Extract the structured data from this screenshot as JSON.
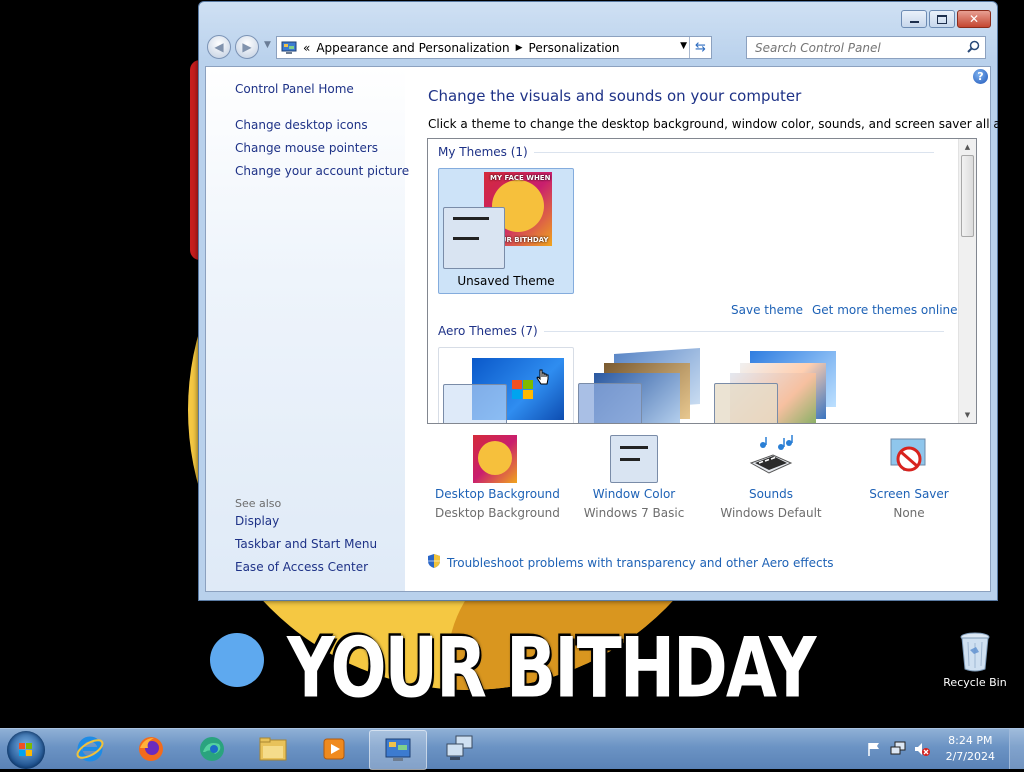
{
  "wallpaper": {
    "caption": "YOUR BITHDAY",
    "meme_text_top": "MY FACE WHEN",
    "meme_text_bottom": "YOUR BITHDAY"
  },
  "desktop": {
    "recycle_bin_label": "Recycle Bin"
  },
  "window": {
    "breadcrumb": {
      "overflow": "«",
      "segments": [
        "Appearance and Personalization",
        "Personalization"
      ]
    },
    "search_placeholder": "Search Control Panel",
    "help_glyph": "?"
  },
  "left_pane": {
    "home": "Control Panel Home",
    "links": [
      "Change desktop icons",
      "Change mouse pointers",
      "Change your account picture"
    ],
    "see_also_label": "See also",
    "see_also": [
      "Display",
      "Taskbar and Start Menu",
      "Ease of Access Center"
    ]
  },
  "main": {
    "title": "Change the visuals and sounds on your computer",
    "description": "Click a theme to change the desktop background, window color, sounds, and screen saver all at once.",
    "my_themes_header": "My Themes (1)",
    "unsaved_theme_label": "Unsaved Theme",
    "save_theme": "Save theme",
    "get_more_themes": "Get more themes online",
    "aero_themes_header": "Aero Themes (7)"
  },
  "bottom": {
    "items": [
      {
        "title": "Desktop Background",
        "subtitle": "Desktop Background",
        "icon": "meme-image-icon"
      },
      {
        "title": "Window Color",
        "subtitle": "Windows 7 Basic",
        "icon": "window-color-icon"
      },
      {
        "title": "Sounds",
        "subtitle": "Windows Default",
        "icon": "sounds-icon"
      },
      {
        "title": "Screen Saver",
        "subtitle": "None",
        "icon": "screen-saver-icon"
      }
    ],
    "troubleshoot": "Troubleshoot problems with transparency and other Aero effects"
  },
  "taskbar": {
    "apps": [
      "internet-explorer-icon",
      "firefox-icon",
      "edge-icon",
      "file-explorer-icon",
      "media-player-icon",
      "control-panel-icon",
      "network-icon"
    ],
    "time": "8:24 PM",
    "date": "2/7/2024"
  },
  "colors": {
    "link": "#1e62b6",
    "heading": "#1e3287",
    "wallpaper_yellow": "#f5c842"
  }
}
